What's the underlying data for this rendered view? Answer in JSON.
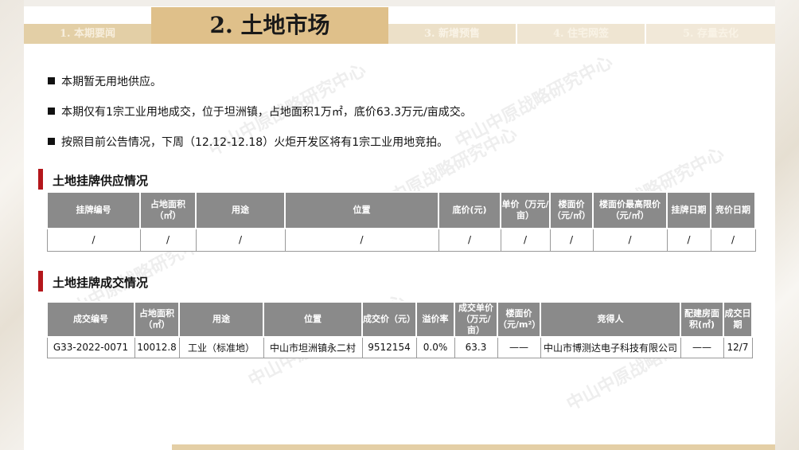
{
  "colors": {
    "accent_gold": "#dfc08a",
    "header_gray": "#8a8a8a",
    "section_red": "#b4161b"
  },
  "tabs": {
    "items": [
      {
        "label": "1. 本期要闻"
      },
      {
        "label": "3. 新增预售"
      },
      {
        "label": "4. 住宅网签"
      },
      {
        "label": "5. 存量去化"
      }
    ],
    "active": {
      "label": "2. 土地市场"
    }
  },
  "bullets": [
    "本期暂无用地供应。",
    "本期仅有1宗工业用地成交，位于坦洲镇，占地面积1万㎡，底价63.3万元/亩成交。",
    "按照目前公告情况，下周（12.12-12.18）火炬开发区将有1宗工业用地竞拍。"
  ],
  "supply": {
    "title": "土地挂牌供应情况",
    "headers": [
      "挂牌编号",
      "占地面积（㎡）",
      "用途",
      "位置",
      "底价(元)",
      "单价（万元/亩）",
      "楼面价（元/㎡）",
      "楼面价最高限价（元/㎡）",
      "挂牌日期",
      "竞价日期"
    ],
    "row": [
      "/",
      "/",
      "/",
      "/",
      "/",
      "/",
      "/",
      "/",
      "/",
      "/"
    ]
  },
  "deal": {
    "title": "土地挂牌成交情况",
    "headers": [
      "成交编号",
      "占地面积（㎡）",
      "用途",
      "位置",
      "成交价（元）",
      "溢价率",
      "成交单价（万元/亩）",
      "楼面价（元/m²）",
      "竞得人",
      "配建房面积(㎡)",
      "成交日期"
    ],
    "row": [
      "G33-2022-0071",
      "10012.8",
      "工业（标准地）",
      "中山市坦洲镇永二村",
      "9512154",
      "0.0%",
      "63.3",
      "——",
      "中山市博测达电子科技有限公司",
      "——",
      "12/7"
    ]
  },
  "watermark": "中山中原战略研究中心"
}
